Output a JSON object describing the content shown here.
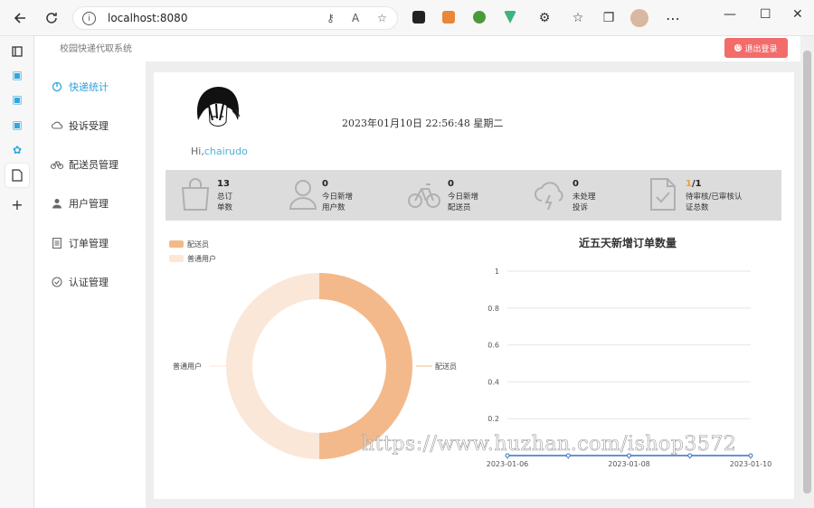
{
  "browser": {
    "url": "localhost:8080"
  },
  "app": {
    "title": "校园快递代取系统",
    "logout_label": "退出登录"
  },
  "menu": {
    "items": [
      {
        "label": "快递统计",
        "icon": "chart-icon",
        "active": true
      },
      {
        "label": "投诉受理",
        "icon": "cloud-icon",
        "active": false
      },
      {
        "label": "配送员管理",
        "icon": "bike-icon",
        "active": false
      },
      {
        "label": "用户管理",
        "icon": "user-icon",
        "active": false
      },
      {
        "label": "订单管理",
        "icon": "list-icon",
        "active": false
      },
      {
        "label": "认证管理",
        "icon": "check-circle-icon",
        "active": false
      }
    ]
  },
  "profile": {
    "greeting": "Hi,",
    "username": "chairudo",
    "datetime": "2023年01月10日 22:56:48 星期二"
  },
  "stats": [
    {
      "value": "13",
      "label1": "总订",
      "label2": "单数",
      "icon": "bag-icon"
    },
    {
      "value": "0",
      "label1": "今日新增",
      "label2": "用户数",
      "icon": "user-outline-icon"
    },
    {
      "value": "0",
      "label1": "今日新增",
      "label2": "配送员",
      "icon": "bike-outline-icon"
    },
    {
      "value": "0",
      "label1": "未处理",
      "label2": "投诉",
      "icon": "storm-cloud-icon"
    },
    {
      "value_pending": "1",
      "value_total": "/1",
      "label1": "待审核/已审核认",
      "label2": "证总数",
      "icon": "doc-check-icon"
    }
  ],
  "chart_data": [
    {
      "type": "pie",
      "legend": [
        "配送员",
        "普通用户"
      ],
      "colors": [
        "#f3b98a",
        "#fbe7d8"
      ],
      "values": [
        1,
        1
      ],
      "slice_labels": [
        "配送员",
        "普通用户"
      ]
    },
    {
      "type": "line",
      "title": "近五天新增订单数量",
      "x": [
        "2023-01-06",
        "2023-01-07",
        "2023-01-08",
        "2023-01-09",
        "2023-01-10"
      ],
      "x_tick_labels": [
        "2023-01-06",
        "2023-01-08",
        "2023-01-10"
      ],
      "series": [
        {
          "values": [
            0,
            0,
            0,
            0,
            0
          ]
        }
      ],
      "y_ticks": [
        "0.2",
        "0.4",
        "0.6",
        "0.8",
        "1"
      ],
      "ylim": [
        0,
        1
      ],
      "grid": true
    }
  ],
  "watermark": "https://www.huzhan.com/ishop3572"
}
